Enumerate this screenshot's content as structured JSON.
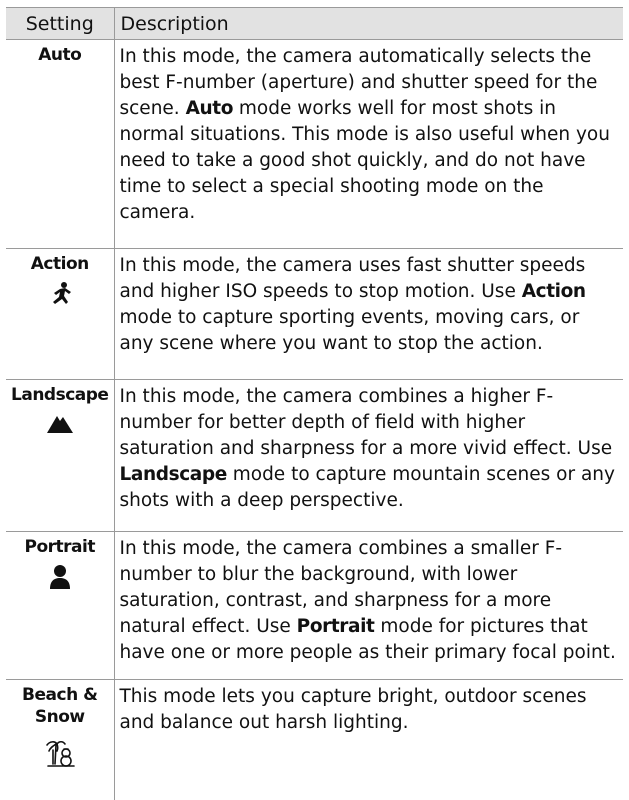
{
  "header": {
    "setting": "Setting",
    "description": "Description"
  },
  "rows": [
    {
      "mode": "Auto",
      "icon": "none",
      "desc_before": "In this mode, the camera automatically selects the best F-number (aperture) and shutter speed for the scene. ",
      "desc_bold": "Auto",
      "desc_after": " mode works well for most shots in normal situations. This mode is also useful when you need to take a good shot quickly, and do not have time to select a special shooting mode on the camera."
    },
    {
      "mode": "Action",
      "icon": "running-person-icon",
      "desc_before": "In this mode, the camera uses fast shutter speeds and higher ISO speeds to stop motion. Use ",
      "desc_bold": "Action",
      "desc_after": " mode to capture sporting events, moving cars, or any scene where you want to stop the action."
    },
    {
      "mode": "Landscape",
      "icon": "mountain-icon",
      "desc_before": "In this mode, the camera combines a higher F-number for better depth of field with higher saturation and sharpness for a more vivid effect. Use ",
      "desc_bold": "Landscape",
      "desc_after": " mode to capture mountain scenes or any shots with a deep perspective."
    },
    {
      "mode": "Portrait",
      "icon": "person-silhouette-icon",
      "desc_before": "In this mode, the camera combines a smaller F-number to blur the background, with lower saturation, contrast, and sharpness for a more natural effect. Use ",
      "desc_bold": "Portrait",
      "desc_after": " mode for pictures that have one or more people as their primary focal point."
    },
    {
      "mode_line1": "Beach &",
      "mode_line2": "Snow",
      "icon": "palm-tree-snowman-icon",
      "desc": "This mode lets you capture bright, outdoor scenes and balance out harsh lighting."
    }
  ]
}
